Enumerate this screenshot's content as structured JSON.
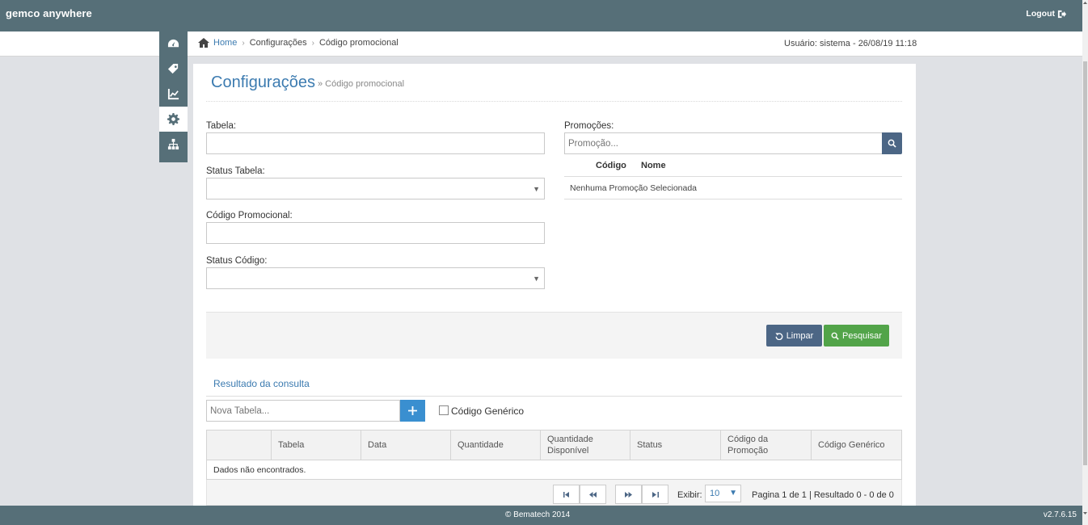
{
  "app": {
    "brand": "gemco anywhere",
    "logout_label": "Logout"
  },
  "breadcrumb": {
    "home": "Home",
    "items": [
      "Configurações",
      "Código promocional"
    ],
    "user_info": "Usuário: sistema - 26/08/19 11:18"
  },
  "sidenav": {
    "icons": [
      "dashboard-icon",
      "tag-icon",
      "chart-icon",
      "gear-icon",
      "sitemap-icon"
    ],
    "active": "gear-icon"
  },
  "page": {
    "title": "Configurações",
    "subtitle": "» Código promocional"
  },
  "form": {
    "tabela_label": "Tabela:",
    "tabela_value": "",
    "status_tabela_label": "Status Tabela:",
    "status_tabela_value": "",
    "codigo_label": "Código Promocional:",
    "codigo_value": "",
    "status_codigo_label": "Status Código:",
    "status_codigo_value": "",
    "promocoes_label": "Promoções:",
    "promocao_placeholder": "Promoção...",
    "promo_col_codigo": "Código",
    "promo_col_nome": "Nome",
    "promo_empty": "Nenhuma Promoção Selecionada"
  },
  "actions": {
    "clear_label": "Limpar",
    "search_label": "Pesquisar"
  },
  "results": {
    "title": "Resultado da consulta",
    "nova_tabela_placeholder": "Nova Tabela...",
    "generic_label": "Código Genérico",
    "columns": [
      "",
      "Tabela",
      "Data",
      "Quantidade",
      "Quantidade Disponível",
      "Status",
      "Código da Promoção",
      "Código Genérico"
    ],
    "empty": "Dados não encontrados."
  },
  "pager": {
    "exibir_label": "Exibir:",
    "page_size": "10",
    "info": "Pagina 1 de 1 | Resultado 0 - 0 de 0"
  },
  "footer": {
    "copyright": "© Bematech 2014",
    "version": "v2.7.6.15"
  },
  "colors": {
    "header_bg": "#566f78",
    "accent_blue": "#3c7bb0",
    "button_slate": "#4c6685",
    "button_green": "#52a449",
    "add_blue": "#3a8fd0"
  }
}
